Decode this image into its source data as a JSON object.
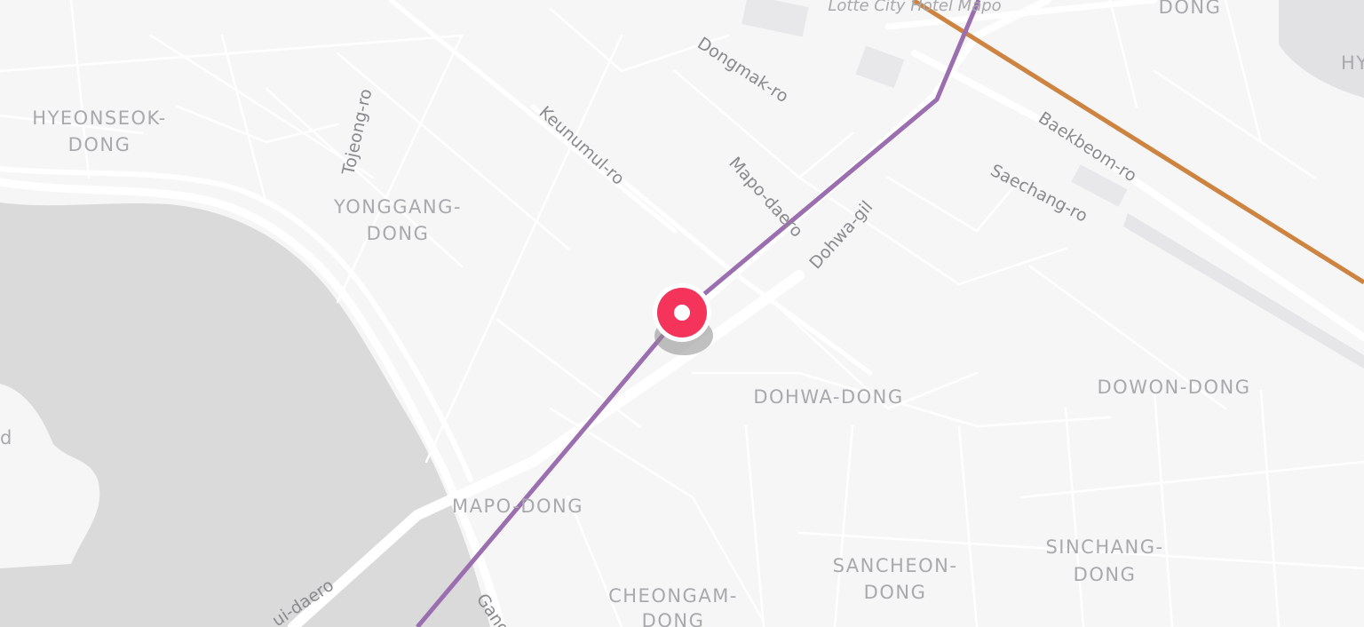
{
  "map": {
    "districts": {
      "hyeonseok": [
        "HYEONSEOK-",
        "DONG"
      ],
      "yonggang": [
        "YONGGANG-",
        "DONG"
      ],
      "dohwa": "DOHWA-DONG",
      "dowon": "DOWON-DONG",
      "mapo": "MAPO-DONG",
      "sincheang": [
        "SINCHANG-",
        "DONG"
      ],
      "sancheon": [
        "SANCHEON-",
        "DONG"
      ],
      "cheongam": [
        "CHEONGAM-",
        "DONG"
      ],
      "top_dong": "DONG",
      "top_right": "HY"
    },
    "roads": {
      "dongmak": "Dongmak-ro",
      "keunumul": "Keunumul-ro",
      "tojeong": "Tojeong-ro",
      "mapo_daero": "Mapo-daero",
      "dohwa_gil": "Dohwa-gil",
      "baekbeom": "Baekbeom-ro",
      "saechang": "Saechang-ro",
      "ui_daero": "ui-daero",
      "gang": "Gang"
    },
    "poi": {
      "lotte": "Lotte City Hotel Mapo"
    },
    "island_fragment": "d",
    "colors": {
      "background": "#f6f6f7",
      "river": "#dadada",
      "road": "#ffffff",
      "subway_line_5": "#9b6eb0",
      "subway_line_6": "#cd8440",
      "marker": "#f4345a"
    },
    "marker_icon": "location-pin-icon"
  }
}
